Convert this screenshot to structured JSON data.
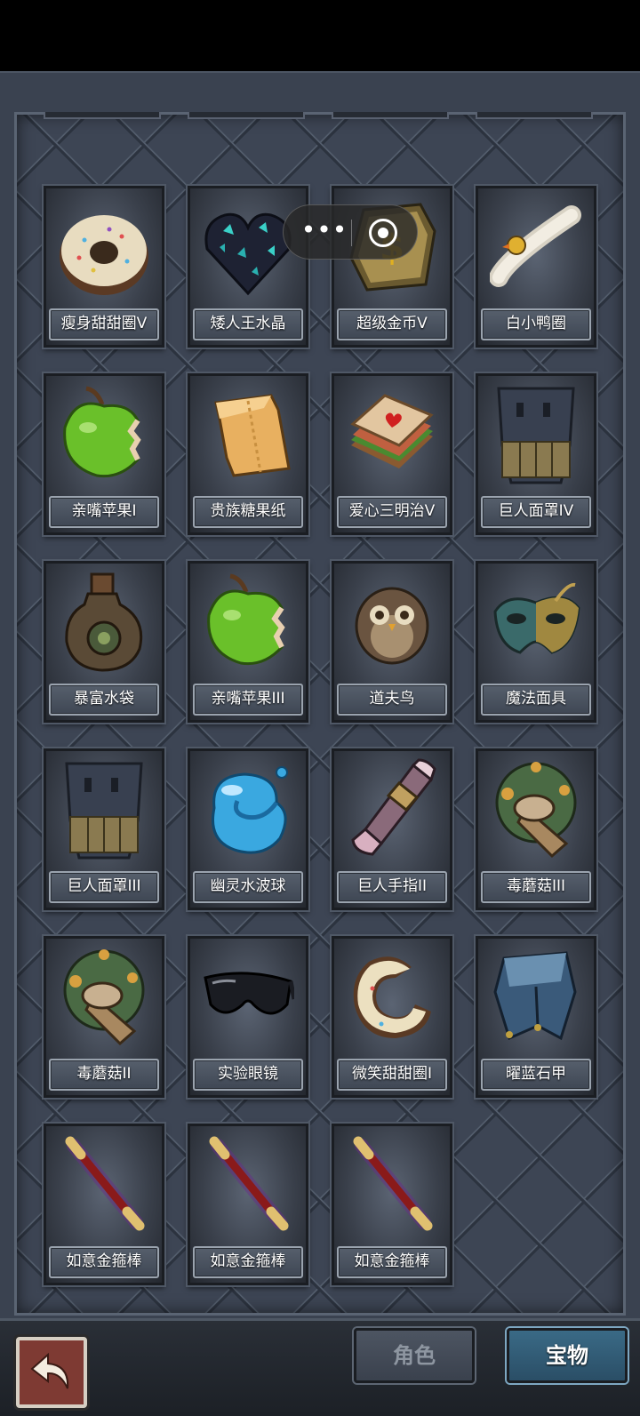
{
  "items": [
    {
      "name": "瘦身甜甜圈V",
      "icon": "donut-icon"
    },
    {
      "name": "矮人王水晶",
      "icon": "crystal-heart-icon"
    },
    {
      "name": "超级金币V",
      "icon": "gold-coin-icon"
    },
    {
      "name": "白小鸭圈",
      "icon": "duck-ring-icon"
    },
    {
      "name": "亲嘴苹果I",
      "icon": "green-apple-icon"
    },
    {
      "name": "贵族糖果纸",
      "icon": "candy-paper-icon"
    },
    {
      "name": "爱心三明治V",
      "icon": "sandwich-icon"
    },
    {
      "name": "巨人面罩IV",
      "icon": "giant-mask-icon"
    },
    {
      "name": "暴富水袋",
      "icon": "water-bag-icon"
    },
    {
      "name": "亲嘴苹果III",
      "icon": "green-apple-icon"
    },
    {
      "name": "道夫鸟",
      "icon": "owl-icon"
    },
    {
      "name": "魔法面具",
      "icon": "magic-mask-icon"
    },
    {
      "name": "巨人面罩III",
      "icon": "giant-mask-icon"
    },
    {
      "name": "幽灵水波球",
      "icon": "water-ball-icon"
    },
    {
      "name": "巨人手指II",
      "icon": "giant-finger-icon"
    },
    {
      "name": "毒蘑菇III",
      "icon": "poison-mushroom-icon"
    },
    {
      "name": "毒蘑菇II",
      "icon": "poison-mushroom-icon"
    },
    {
      "name": "实验眼镜",
      "icon": "sunglasses-icon"
    },
    {
      "name": "微笑甜甜圈I",
      "icon": "bitten-donut-icon"
    },
    {
      "name": "曜蓝石甲",
      "icon": "blue-armor-icon"
    },
    {
      "name": "如意金箍棒",
      "icon": "golden-staff-icon"
    },
    {
      "name": "如意金箍棒",
      "icon": "golden-staff-icon"
    },
    {
      "name": "如意金箍棒",
      "icon": "golden-staff-icon"
    }
  ],
  "capsule": {
    "more_icon": "more-dots-icon",
    "close_icon": "target-icon"
  },
  "tabs": {
    "role": "角色",
    "treasure": "宝物"
  },
  "back_icon": "back-arrow-icon",
  "colors": {
    "active_tab": "#2a4e66",
    "inactive_tab": "#3a414d",
    "back_button": "#7e3a33"
  }
}
